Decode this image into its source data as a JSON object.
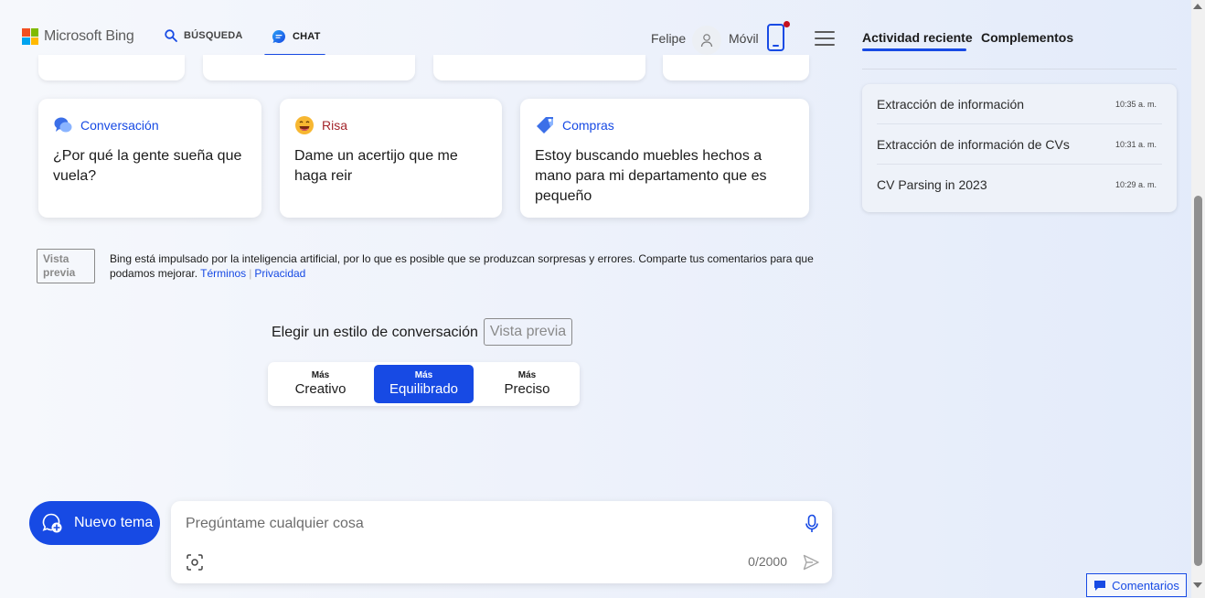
{
  "header": {
    "logo_text": "Microsoft Bing",
    "tabs": [
      {
        "label": "BÚSQUEDA",
        "icon": "search-icon"
      },
      {
        "label": "CHAT",
        "icon": "chat-icon"
      }
    ],
    "user_name": "Felipe",
    "mobile_label": "Móvil"
  },
  "right_panel": {
    "tabs": [
      "Actividad reciente",
      "Complementos"
    ],
    "recent": [
      {
        "title": "Extracción de información",
        "time": "10:35 a. m."
      },
      {
        "title": "Extracción de información de CVs",
        "time": "10:31 a. m."
      },
      {
        "title": "CV Parsing in 2023",
        "time": "10:29 a. m."
      }
    ]
  },
  "suggestions": [
    {
      "category": "Conversación",
      "category_color": "#174ae4",
      "text": "¿Por qué la gente sueña que vuela?",
      "icon": "speech-bubbles-icon"
    },
    {
      "category": "Risa",
      "category_color": "#a4262c",
      "text": "Dame un acertijo que me haga reir",
      "icon": "laughing-face-icon"
    },
    {
      "category": "Compras",
      "category_color": "#174ae4",
      "text": "Estoy buscando muebles hechos a mano para mi departamento que es pequeño",
      "icon": "price-tag-icon"
    }
  ],
  "disclaimer": {
    "badge": "Vista previa",
    "text": "Bing está impulsado por la inteligencia artificial, por lo que es posible que se produzcan sorpresas y errores. Comparte tus comentarios para que podamos mejorar.",
    "link_terms": "Términos",
    "link_privacy": "Privacidad"
  },
  "style_selector": {
    "title": "Elegir un estilo de conversación",
    "badge": "Vista previa",
    "options": [
      {
        "small": "Más",
        "label": "Creativo"
      },
      {
        "small": "Más",
        "label": "Equilibrado",
        "selected": true
      },
      {
        "small": "Más",
        "label": "Preciso"
      }
    ]
  },
  "composer": {
    "new_topic_label": "Nuevo tema",
    "placeholder": "Pregúntame cualquier cosa",
    "value": "",
    "counter": "0/2000"
  },
  "feedback_label": "Comentarios",
  "colors": {
    "accent": "#174ae4",
    "notification": "#c50f1f"
  }
}
